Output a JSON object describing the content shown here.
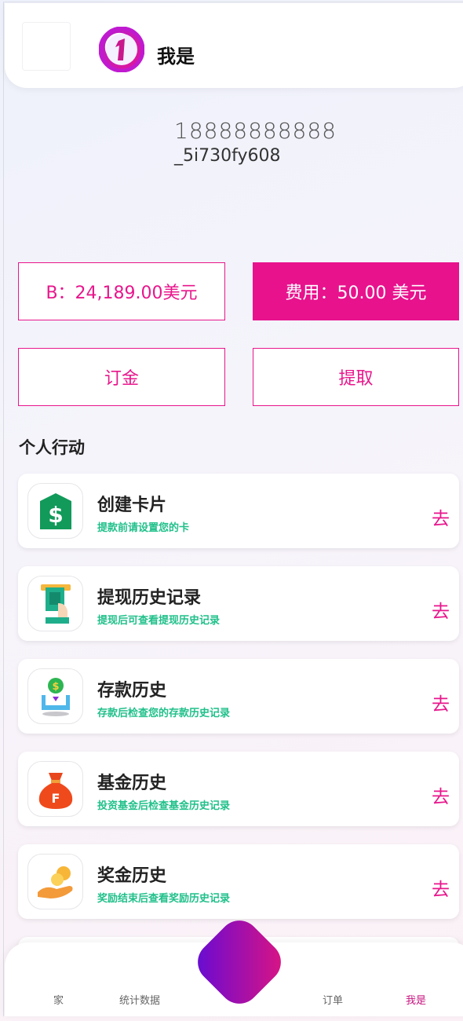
{
  "header": {
    "title": "我是"
  },
  "user": {
    "phone": "18888888888",
    "id": "_5i730fy608"
  },
  "balance": {
    "label": "B：24,189.00美元",
    "fee_label": "费用：50.00 美元"
  },
  "buttons": {
    "deposit": "订金",
    "withdraw": "提取"
  },
  "section": {
    "title": "个人行动"
  },
  "actions": [
    {
      "title": "创建卡片",
      "subtitle": "提款前请设置您的卡",
      "go": "去",
      "icon": "dollar-card-icon"
    },
    {
      "title": "提现历史记录",
      "subtitle": "提现后可查看提现历史记录",
      "go": "去",
      "icon": "atm-withdraw-icon"
    },
    {
      "title": "存款历史",
      "subtitle": "存款后检查您的存款历史记录",
      "go": "去",
      "icon": "coin-deposit-icon"
    },
    {
      "title": "基金历史",
      "subtitle": "投资基金后检查基金历史记录",
      "go": "去",
      "icon": "money-bag-icon"
    },
    {
      "title": "奖金历史",
      "subtitle": "奖励结束后查看奖励历史记录",
      "go": "去",
      "icon": "hand-coins-icon"
    }
  ],
  "nav": [
    {
      "label": "家"
    },
    {
      "label": "统计数据"
    },
    {
      "label": "订单"
    },
    {
      "label": "我是"
    }
  ],
  "colors": {
    "accent": "#e8128d",
    "subtitle": "#21c08b"
  }
}
